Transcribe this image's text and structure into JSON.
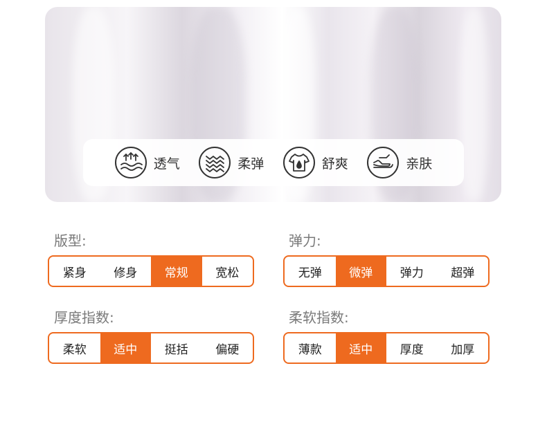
{
  "features": [
    {
      "label": "透气",
      "icon": "breathable-icon"
    },
    {
      "label": "柔弹",
      "icon": "stretch-waves-icon"
    },
    {
      "label": "舒爽",
      "icon": "shirt-droplet-icon"
    },
    {
      "label": "亲肤",
      "icon": "hand-skin-icon"
    }
  ],
  "groups": {
    "fit": {
      "title": "版型:",
      "options": [
        "紧身",
        "修身",
        "常规",
        "宽松"
      ],
      "selected": "常规"
    },
    "elasticity": {
      "title": "弹力:",
      "options": [
        "无弹",
        "微弹",
        "弹力",
        "超弹"
      ],
      "selected": "微弹"
    },
    "thickness": {
      "title": "厚度指数:",
      "options": [
        "柔软",
        "适中",
        "挺括",
        "偏硬"
      ],
      "selected": "适中"
    },
    "softness": {
      "title": "柔软指数:",
      "options": [
        "薄款",
        "适中",
        "厚度",
        "加厚"
      ],
      "selected": "适中"
    }
  },
  "colors": {
    "accent": "#ee6a1f",
    "text": "#222222",
    "muted": "#7a7a7a"
  }
}
